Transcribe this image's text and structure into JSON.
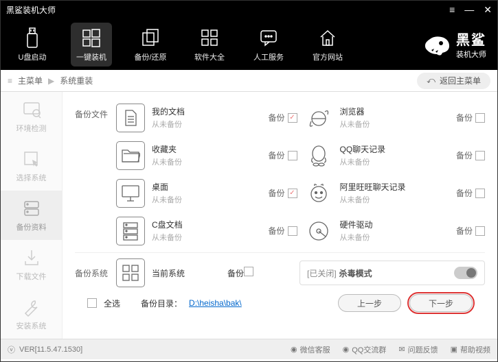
{
  "window": {
    "title": "黑鲨装机大师"
  },
  "nav": {
    "usb": "U盘启动",
    "onekey": "一键装机",
    "backup": "备份/还原",
    "software": "软件大全",
    "service": "人工服务",
    "site": "官方网站"
  },
  "brand": {
    "name": "黑鲨",
    "sub": "装机大师"
  },
  "crumb": {
    "root": "主菜单",
    "current": "系统重装",
    "back": "返回主菜单"
  },
  "side": {
    "env": "环境检测",
    "select": "选择系统",
    "backup": "备份资料",
    "download": "下载文件",
    "install": "安装系统"
  },
  "section": {
    "files": "备份文件",
    "system": "备份系统"
  },
  "items": {
    "docs": {
      "name": "我的文档",
      "sub": "从未备份"
    },
    "browser": {
      "name": "浏览器",
      "sub": "从未备份"
    },
    "fav": {
      "name": "收藏夹",
      "sub": "从未备份"
    },
    "qq": {
      "name": "QQ聊天记录",
      "sub": "从未备份"
    },
    "desktop": {
      "name": "桌面",
      "sub": "从未备份"
    },
    "ali": {
      "name": "阿里旺旺聊天记录",
      "sub": "从未备份"
    },
    "cdrive": {
      "name": "C盘文档",
      "sub": "从未备份"
    },
    "driver": {
      "name": "硬件驱动",
      "sub": "从未备份"
    },
    "cursys": {
      "name": "当前系统"
    }
  },
  "labels": {
    "backup": "备份"
  },
  "kill": {
    "prefix": "[已关闭]",
    "text": "杀毒模式"
  },
  "bottom": {
    "selectall": "全选",
    "dirlabel": "备份目录：",
    "dir": "D:\\heisha\\bak\\",
    "prev": "上一步",
    "next": "下一步"
  },
  "status": {
    "ver": "VER[11.5.47.1530]",
    "wx": "微信客服",
    "qqg": "QQ交流群",
    "fb": "问题反馈",
    "help": "帮助视频"
  }
}
